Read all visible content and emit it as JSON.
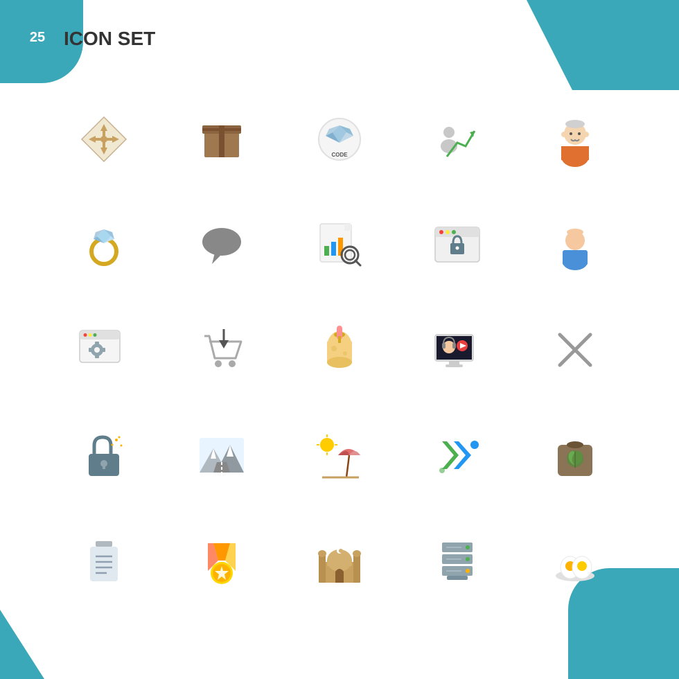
{
  "page": {
    "title": "ICON SET",
    "badge": "25",
    "background": "#ffffff",
    "accent": "#3aa8b8"
  },
  "icons": [
    {
      "id": "move-arrows",
      "label": "Move/Drag arrows"
    },
    {
      "id": "box-package",
      "label": "Box/Package"
    },
    {
      "id": "code-badge",
      "label": "Code badge"
    },
    {
      "id": "growth-chart",
      "label": "Growth chart"
    },
    {
      "id": "old-man",
      "label": "Old man avatar"
    },
    {
      "id": "diamond-ring",
      "label": "Diamond ring"
    },
    {
      "id": "chat-bubble",
      "label": "Chat bubble"
    },
    {
      "id": "data-search",
      "label": "Data search/analytics"
    },
    {
      "id": "secure-browser",
      "label": "Secure browser/lock"
    },
    {
      "id": "person-blue",
      "label": "Person blue jacket"
    },
    {
      "id": "web-settings",
      "label": "Web settings/gear"
    },
    {
      "id": "shopping-cart-download",
      "label": "Shopping cart download"
    },
    {
      "id": "ice-cream-bag",
      "label": "Ice cream bag"
    },
    {
      "id": "video-support",
      "label": "Video support/monitor"
    },
    {
      "id": "cross-scissors",
      "label": "Cross/scissors"
    },
    {
      "id": "unlock-padlock",
      "label": "Unlocked padlock"
    },
    {
      "id": "mountains-road",
      "label": "Mountains road"
    },
    {
      "id": "beach-sun",
      "label": "Beach sun umbrella"
    },
    {
      "id": "chevron-arrows",
      "label": "Chevron arrows right"
    },
    {
      "id": "seed-bag",
      "label": "Seed/plant bag"
    },
    {
      "id": "document-list",
      "label": "Document list"
    },
    {
      "id": "medal-ribbon",
      "label": "Medal ribbon"
    },
    {
      "id": "mosque",
      "label": "Mosque building"
    },
    {
      "id": "server-rack",
      "label": "Server rack"
    },
    {
      "id": "eggs-plate",
      "label": "Eggs on plate"
    }
  ]
}
